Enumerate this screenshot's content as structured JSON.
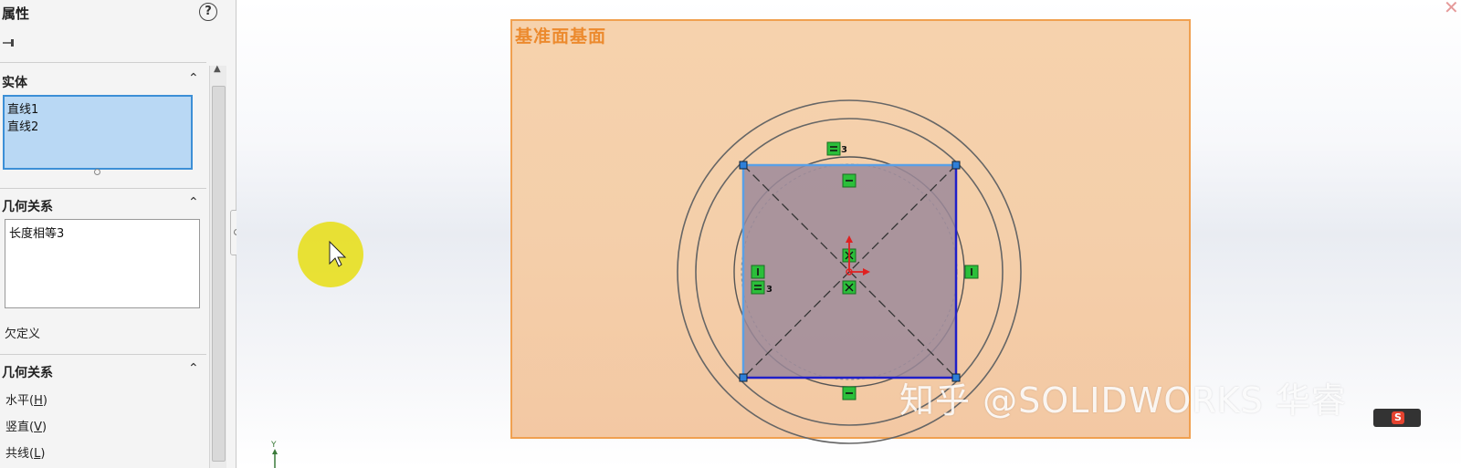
{
  "panel": {
    "title": "属性",
    "help_icon": "help-icon",
    "pin_icon": "pushpin-icon",
    "entities_header": "实体",
    "entities": [
      "直线1",
      "直线2"
    ],
    "existing_relations_header": "几何关系",
    "existing_relations": [
      "长度相等3"
    ],
    "status": "欠定义",
    "add_relations_header": "几何关系",
    "add_relations": [
      {
        "label": "水平",
        "key": "H"
      },
      {
        "label": "竖直",
        "key": "V"
      },
      {
        "label": "共线",
        "key": "L"
      }
    ]
  },
  "sketch": {
    "plane_label": "基准面基面",
    "eq_label": "3",
    "axis_label": "Y"
  },
  "watermark": "知乎 @SOLIDWORKS 华睿",
  "colors": {
    "selection_blue": "#3c8fd6",
    "plane_orange": "#f0a050",
    "relation_green": "#2bbf3a"
  }
}
